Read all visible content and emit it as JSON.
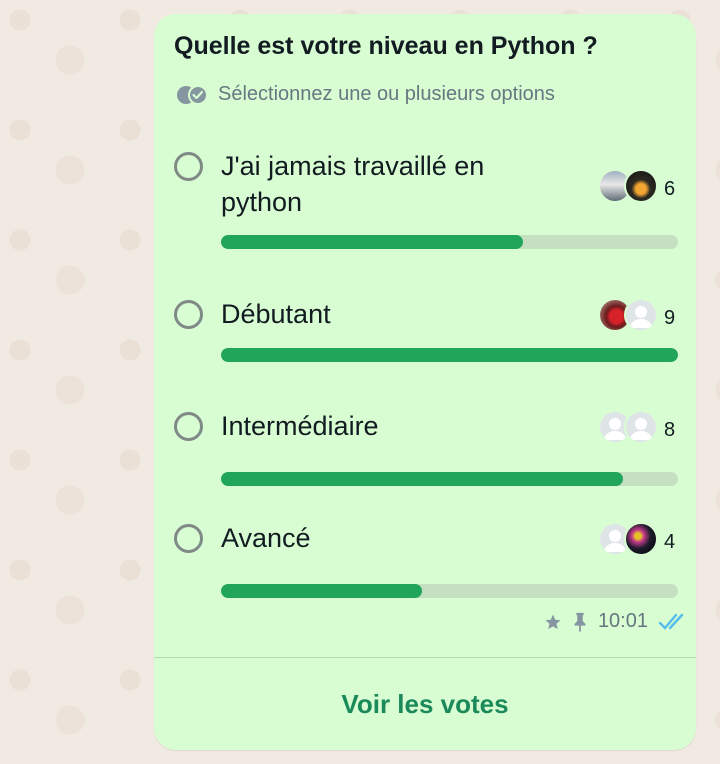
{
  "poll": {
    "question": "Quelle est votre niveau en Python ?",
    "subtitle": "Sélectionnez une ou plusieurs options",
    "subtitle_icon": "double-check-circle-icon",
    "options": [
      {
        "label": "J'ai jamais travaillé en python",
        "votes": "6",
        "fill_fraction": 0.66
      },
      {
        "label": "Débutant",
        "votes": "9",
        "fill_fraction": 1.0
      },
      {
        "label": "Intermédiaire",
        "votes": "8",
        "fill_fraction": 0.88
      },
      {
        "label": "Avancé",
        "votes": "4",
        "fill_fraction": 0.44
      }
    ],
    "bar_color": "#21a55a",
    "bar_track_color": "#c4e0c0"
  },
  "message": {
    "time": "10:01",
    "starred_icon": "star-icon",
    "pinned_icon": "pin-icon",
    "read_icon": "double-check-read-icon",
    "read_color": "#53bdeb"
  },
  "footer": {
    "view_votes_label": "Voir les votes"
  },
  "colors": {
    "bubble": "#d9fdd3",
    "accent": "#1b8a5a"
  }
}
